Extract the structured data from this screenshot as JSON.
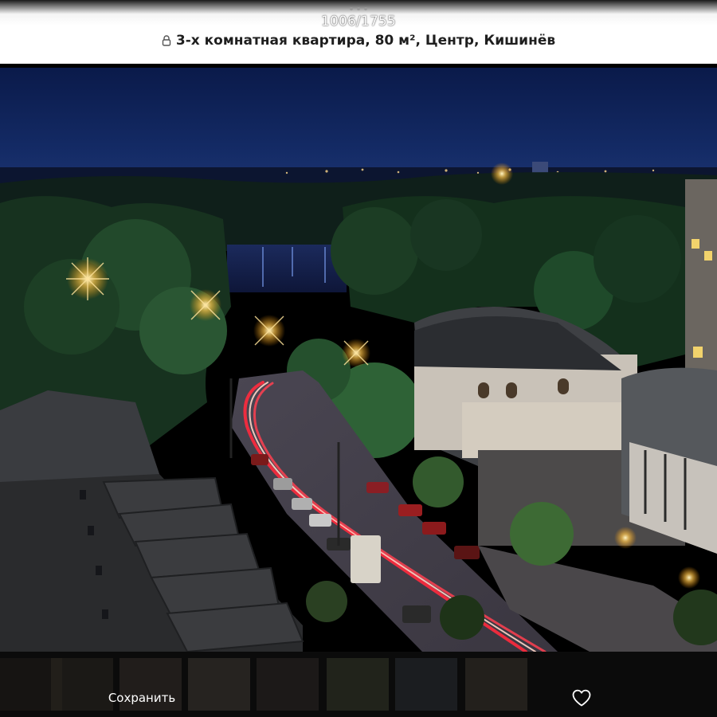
{
  "viewer": {
    "counter": "1006/1755",
    "listing_title": "3-х комнатная квартира, 80 м², Центр, Кишинёв",
    "title_icon": "lock-icon"
  },
  "photo": {
    "subject": "night cityscape"
  },
  "actions": {
    "save_label": "Сохранить",
    "like_icon": "heart-icon"
  },
  "colors": {
    "header_bg": "#ffffff",
    "title_text": "#1f1f1f",
    "bottom_bar_bg": "#0b0b0b",
    "action_text": "#ffffff"
  }
}
